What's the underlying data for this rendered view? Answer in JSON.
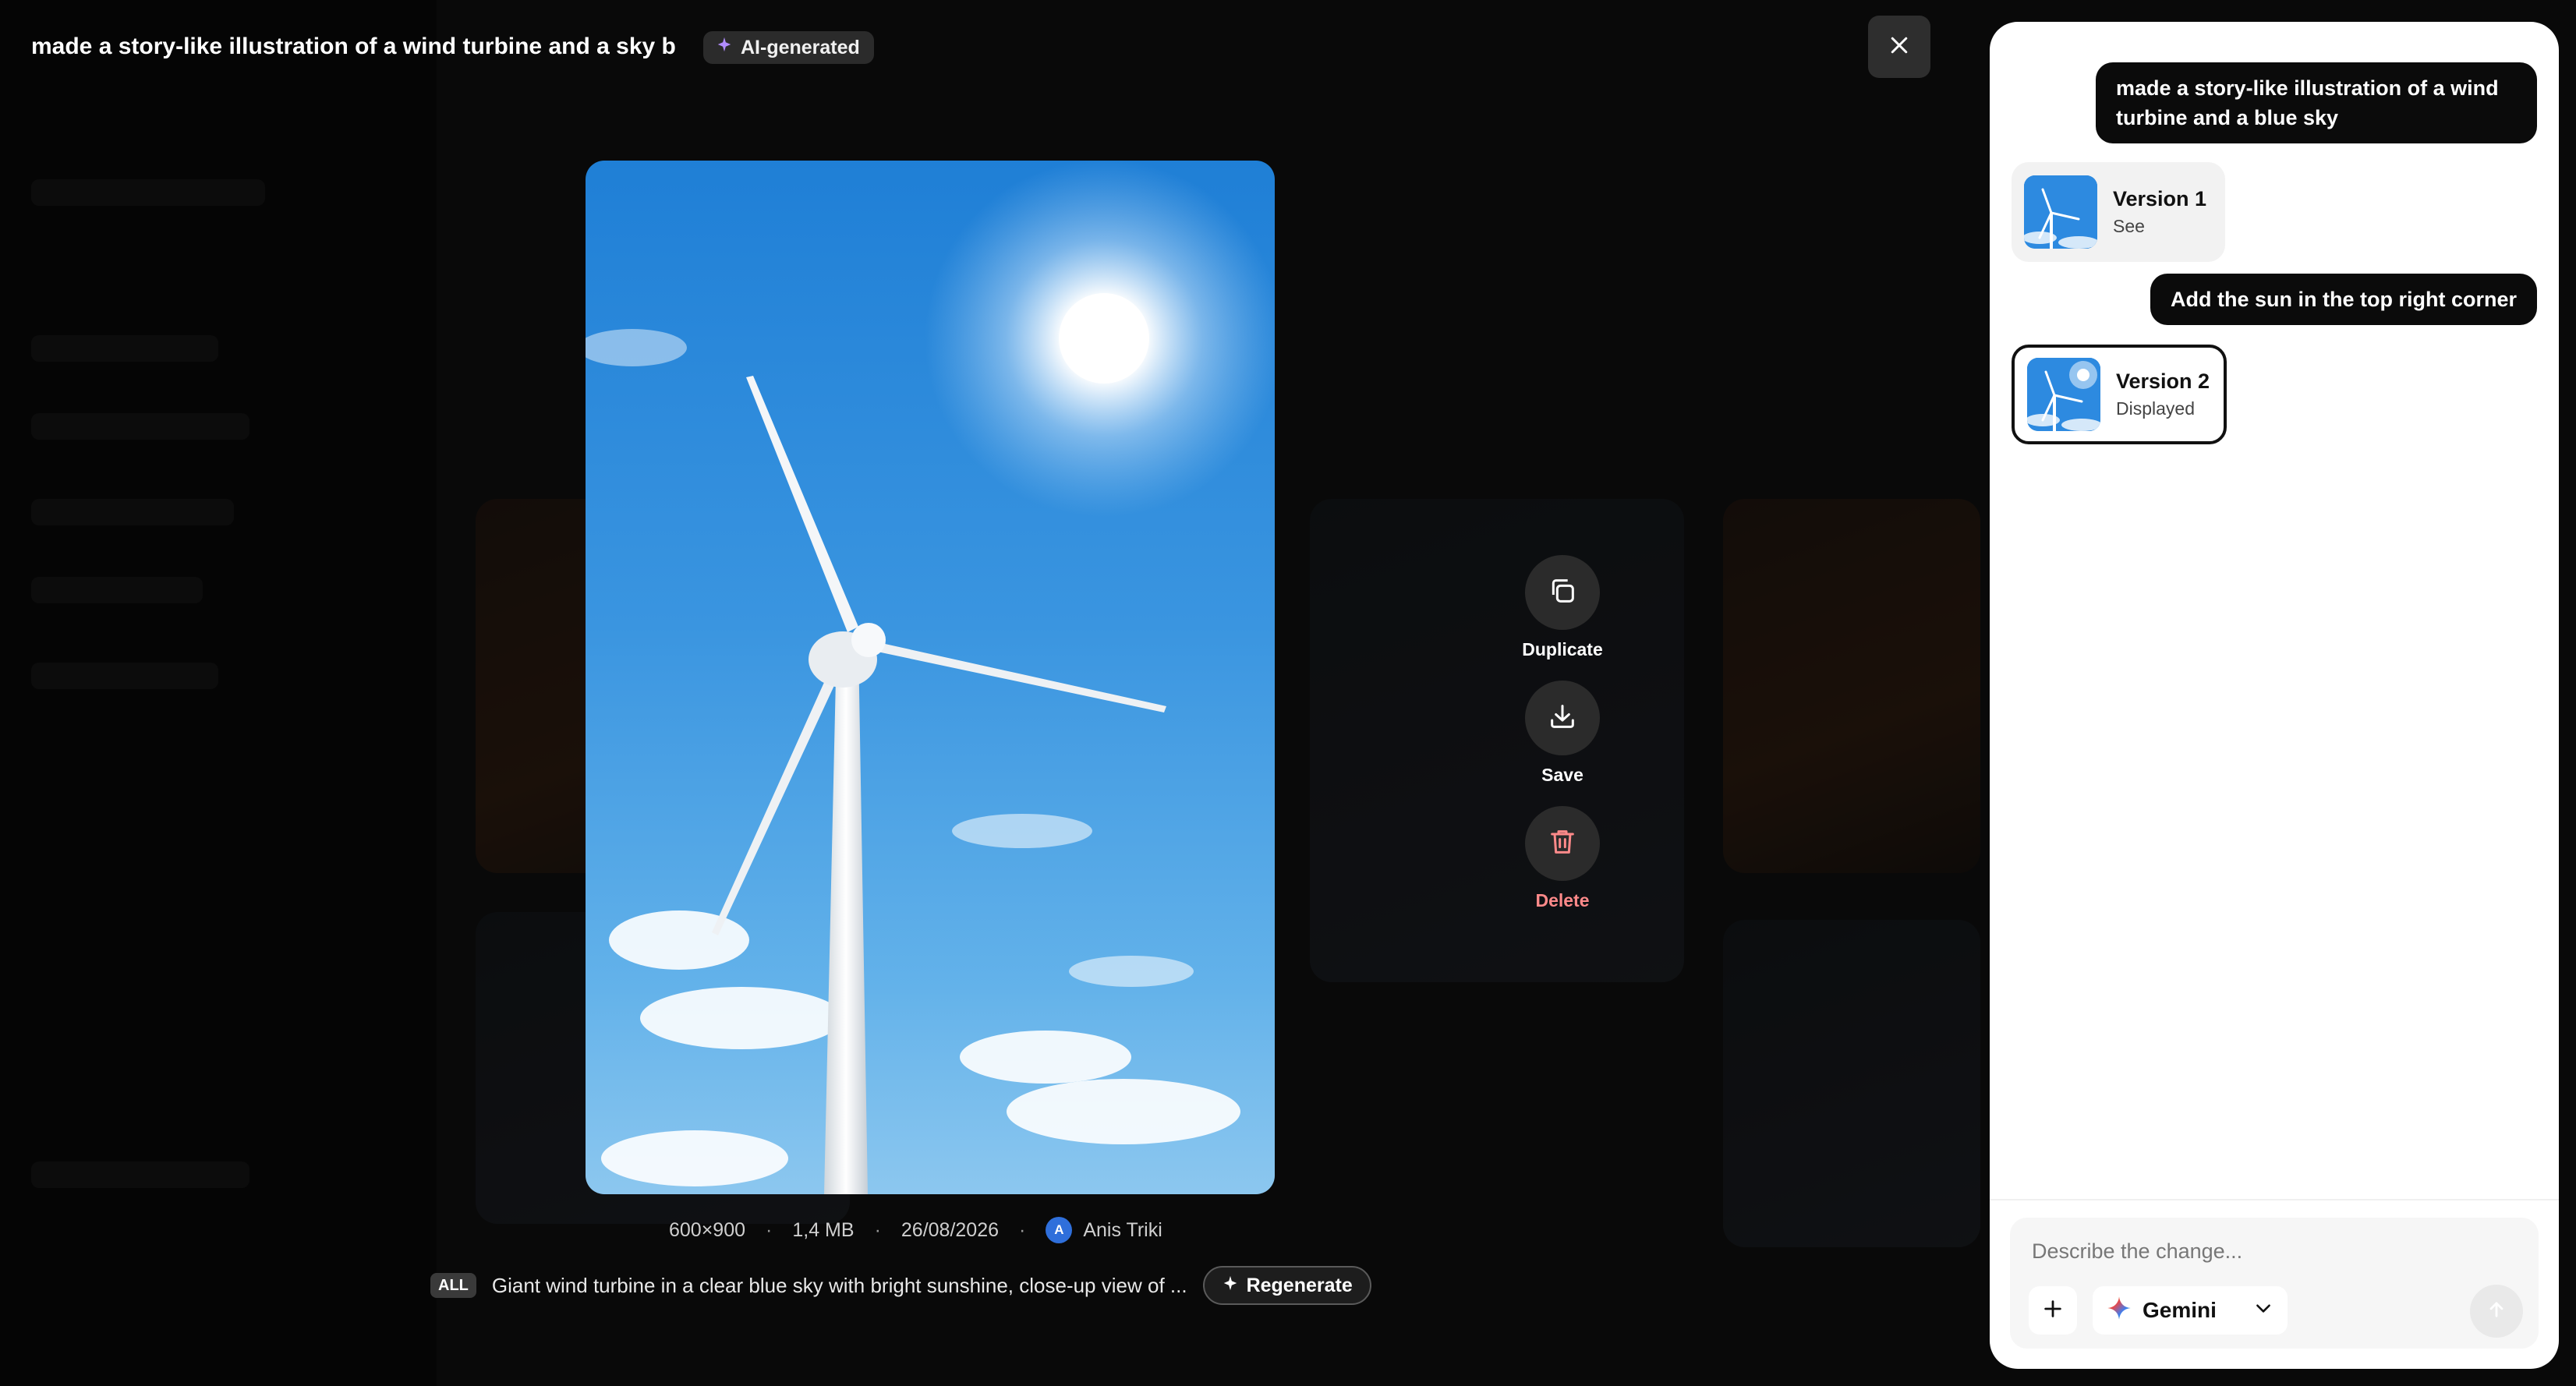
{
  "header": {
    "title": "made a story-like illustration of a wind turbine and a sky b",
    "ai_badge": "AI-generated"
  },
  "icons": {
    "close": "close-icon",
    "ai_spark": "sparkle-icon",
    "duplicate": "duplicate-icon",
    "save": "download-icon",
    "delete": "trash-icon",
    "regenerate": "sparkle-icon",
    "add": "plus-icon",
    "model": "gemini-star-icon",
    "model_dropdown": "chevron-down-icon",
    "send": "arrow-up-icon"
  },
  "actions": {
    "duplicate": "Duplicate",
    "save": "Save",
    "delete": "Delete"
  },
  "meta": {
    "dimensions": "600×900",
    "size": "1,4 MB",
    "date": "26/08/2026",
    "author_initial": "A",
    "author": "Anis Triki"
  },
  "prompt": {
    "scope": "ALL",
    "text": "Giant wind turbine in a clear blue sky with bright sunshine, close-up view of ...",
    "regenerate": "Regenerate"
  },
  "chat": {
    "messages": [
      {
        "text": "made a story-like illustration of a wind turbine and a blue sky"
      },
      {
        "text": "Add the sun in the top right corner"
      }
    ],
    "versions": [
      {
        "title": "Version 1",
        "status": "See"
      },
      {
        "title": "Version 2",
        "status": "Displayed"
      }
    ]
  },
  "composer": {
    "placeholder": "Describe the change...",
    "model": "Gemini"
  },
  "colors": {
    "delete": "#ff8a8a",
    "ai_spark": "#b18cff",
    "avatar": "#2f6fdb"
  }
}
